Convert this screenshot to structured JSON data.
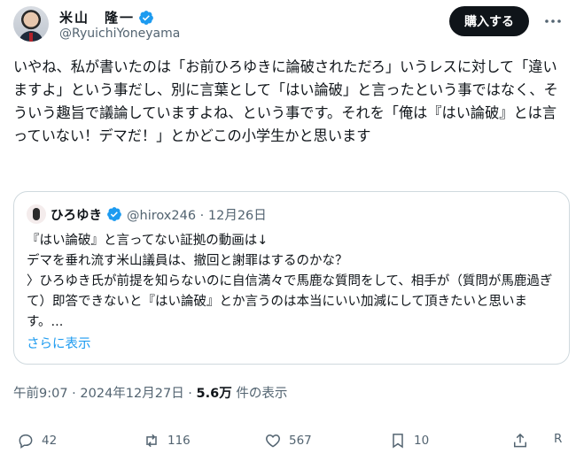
{
  "author": {
    "display_name": "米山　隆一",
    "handle": "@RyuichiYoneyama"
  },
  "header": {
    "buy_label": "購入する"
  },
  "tweet": {
    "text": "いやね、私が書いたのは「お前ひろゆきに論破されただろ」いうレスに対して「違いますよ」という事だし、別に言葉として「はい論破」と言ったという事ではなく、そういう趣旨で議論していますよね、という事です。それを「俺は『はい論破』とは言っていない！デマだ！」とかどこの小学生かと思います",
    "timestamp": "午前9:07 · 2024年12月27日",
    "separator": " · ",
    "views_count": "5.6万",
    "views_label": " 件の表示"
  },
  "quote": {
    "name": "ひろゆき",
    "handle_date": "@hirox246 · 12月26日",
    "text": "『はい論破』と言ってない証拠の動画は↓\nデマを垂れ流す米山議員は、撤回と謝罪はするのかな？\n〉ひろゆき氏が前提を知らないのに自信満々で馬鹿な質問をして、相手が（質問が馬鹿過ぎて）即答できないと『はい論破』とか言うのは本当にいい加減にして頂きたいと思います。...",
    "show_more": "さらに表示"
  },
  "actions": {
    "replies": "42",
    "reposts": "116",
    "likes": "567",
    "bookmarks": "10",
    "extra": "R"
  },
  "colors": {
    "accent": "#1d9bf0",
    "text": "#0f1419",
    "muted": "#536471",
    "border": "#cfd9de"
  }
}
